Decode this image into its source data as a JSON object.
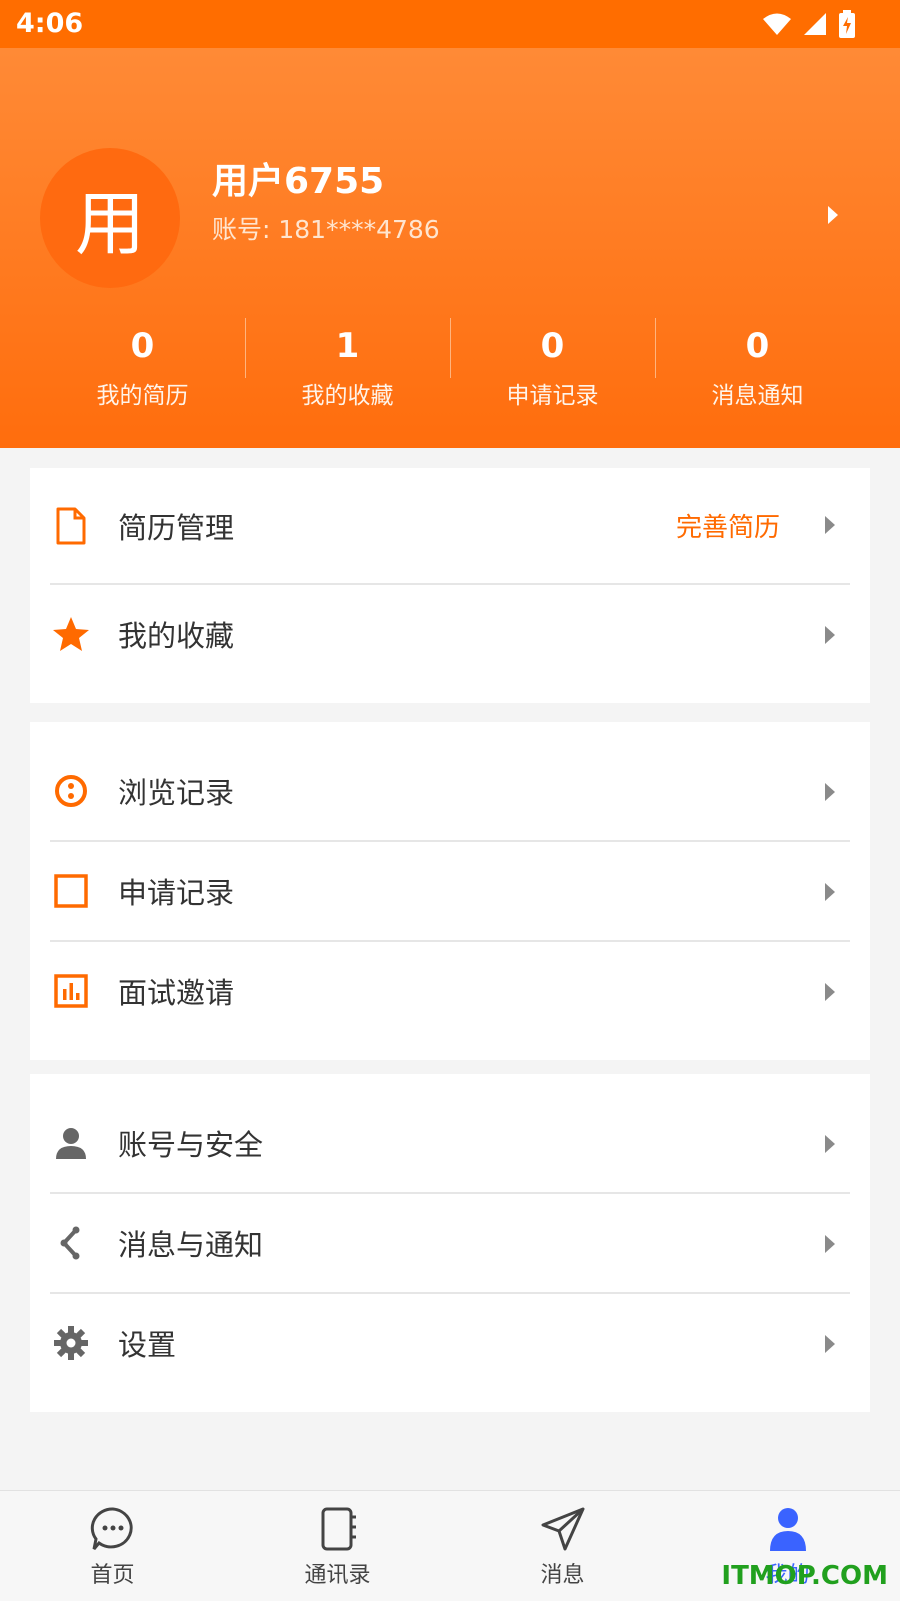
{
  "status_bar": {
    "time": "4:06"
  },
  "profile": {
    "avatar_char": "用",
    "name": "用户6755",
    "account": "账号: 181****4786"
  },
  "stats": [
    {
      "count": "0",
      "label": "我的简历"
    },
    {
      "count": "1",
      "label": "我的收藏"
    },
    {
      "count": "0",
      "label": "申请记录"
    },
    {
      "count": "0",
      "label": "消息通知"
    }
  ],
  "card1": [
    {
      "label": "简历管理",
      "extra": "完善简历",
      "icon": "document-icon"
    },
    {
      "label": "我的收藏",
      "icon": "star-icon"
    }
  ],
  "card2": [
    {
      "label": "浏览记录",
      "icon": "browse-icon"
    },
    {
      "label": "申请记录",
      "icon": "square-icon"
    },
    {
      "label": "面试邀请",
      "icon": "chart-icon"
    }
  ],
  "card3": [
    {
      "label": "账号与安全",
      "icon": "person-icon"
    },
    {
      "label": "消息与通知",
      "icon": "share-icon"
    },
    {
      "label": "设置",
      "icon": "gear-icon"
    }
  ],
  "bottom_nav": [
    {
      "label": "首页",
      "icon": "chat-bubble-icon"
    },
    {
      "label": "通讯录",
      "icon": "contacts-book-icon"
    },
    {
      "label": "消息",
      "icon": "send-icon"
    },
    {
      "label": "我的",
      "icon": "user-icon",
      "active": true
    }
  ],
  "watermark": "ITMOP.COM",
  "colors": {
    "accent": "#ff6d00",
    "nav_active": "#3a63ff"
  }
}
